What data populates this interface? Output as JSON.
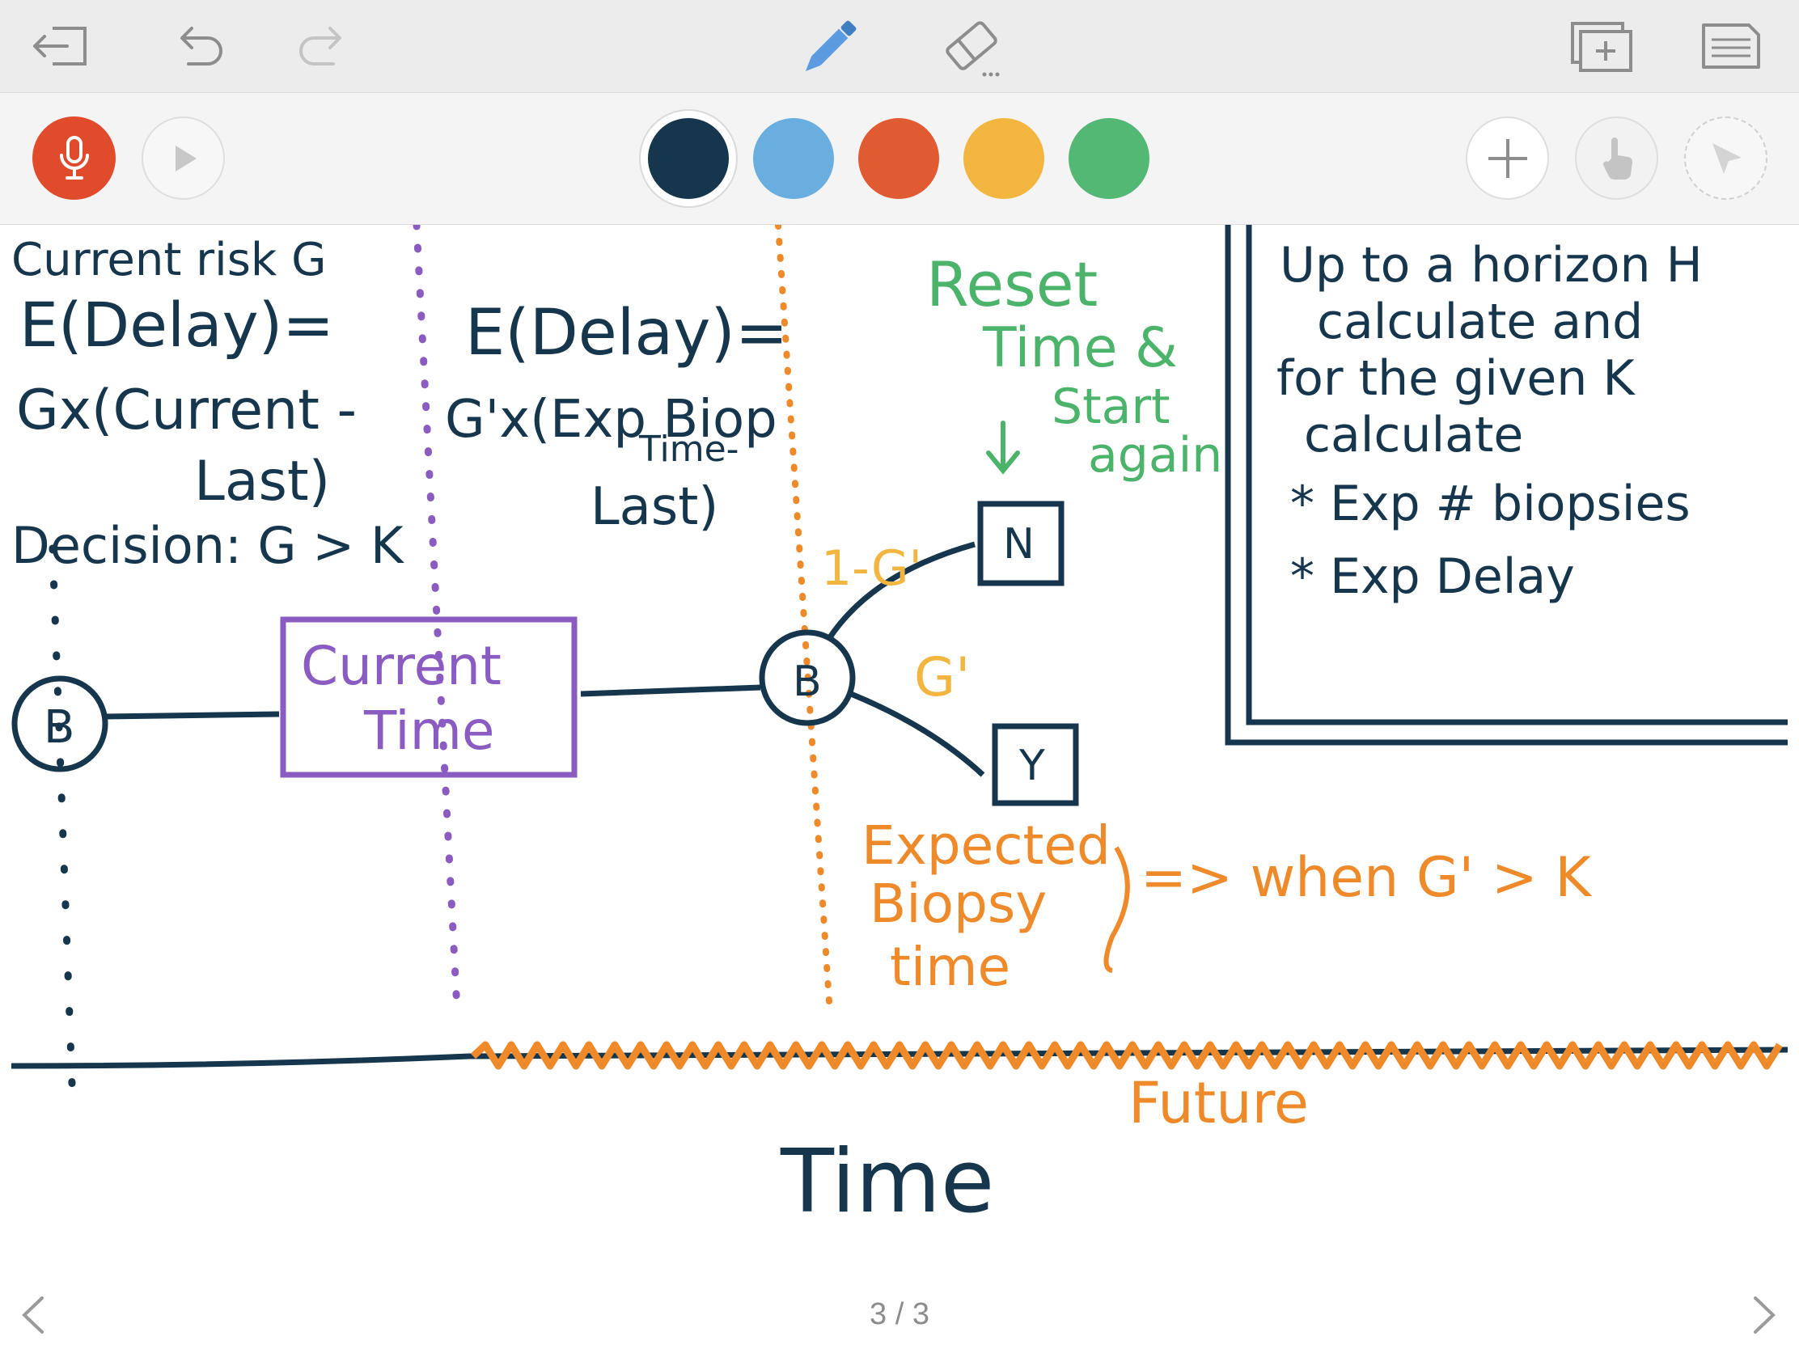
{
  "toolbar": {
    "exit_icon": "exit-icon",
    "undo_icon": "undo-icon",
    "redo_icon": "redo-icon",
    "pen_icon": "pen-icon",
    "eraser_icon": "eraser-icon",
    "add_page_icon": "add-page-icon",
    "pages_icon": "pages-icon"
  },
  "tools": {
    "mic_icon": "microphone-icon",
    "play_icon": "play-icon",
    "colors": [
      "#15364c",
      "#6aaee0",
      "#e05a32",
      "#f2b640",
      "#52b874"
    ],
    "selected_color_index": 0,
    "add_icon": "plus-icon",
    "hand_icon": "hand-pointer-icon",
    "laser_icon": "laser-pointer-icon"
  },
  "canvas": {
    "left_notes": [
      "Current risk G",
      "E(Delay)=",
      "Gx(Current -",
      "Last)",
      "Decision: G > K"
    ],
    "mid_notes": [
      "E(Delay)=",
      "G'x(Exp Biop",
      "Time-",
      "Last)"
    ],
    "green_notes": [
      "Reset",
      "Time &",
      "Start",
      "again"
    ],
    "right_box": [
      "Up to a horizon H",
      "calculate and",
      "for the given K",
      "calculate",
      "* Exp # biopsies",
      "* Exp Delay"
    ],
    "node_b_left": "B",
    "current_time_box": [
      "Current",
      "Time"
    ],
    "node_b_mid": "B",
    "branch_upper": "1-G'",
    "branch_lower": "G'",
    "node_n": "N",
    "node_y": "Y",
    "expected_notes": [
      "Expected",
      "Biopsy",
      "time"
    ],
    "when_note": "=> when G' > K",
    "future_label": "Future",
    "time_label": "Time"
  },
  "footer": {
    "page_indicator": "3 / 3",
    "prev_icon": "chevron-left-icon",
    "next_icon": "chevron-right-icon"
  }
}
